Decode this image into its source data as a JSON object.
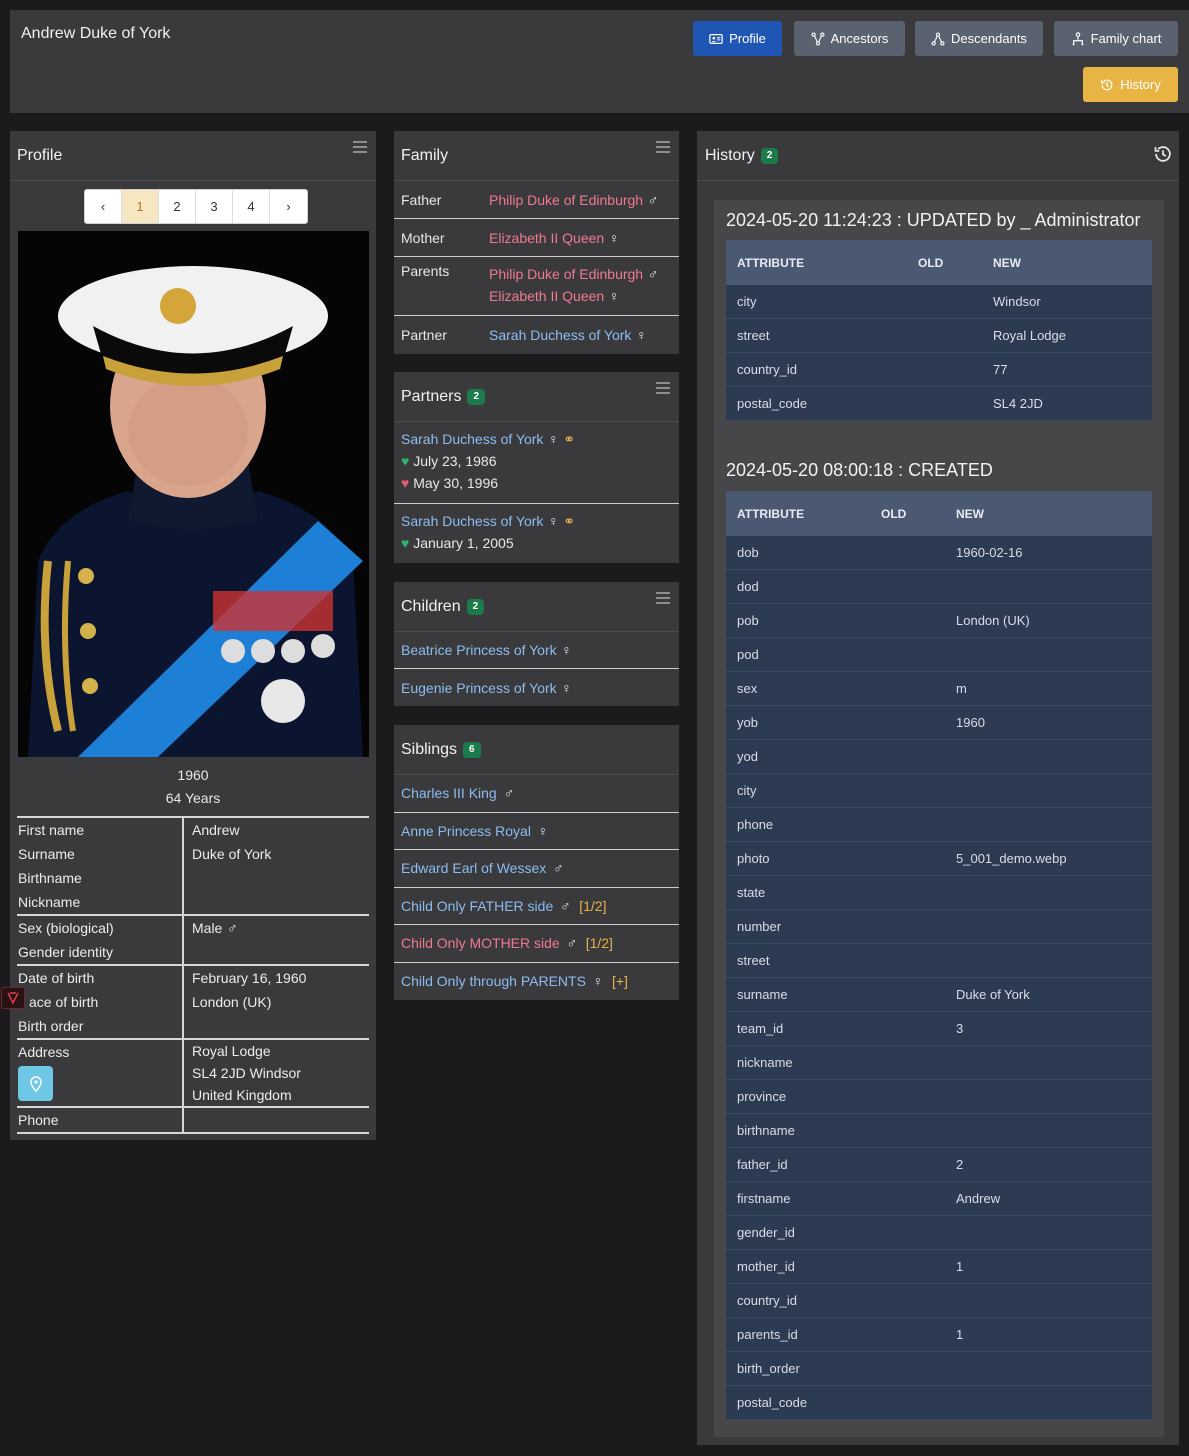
{
  "header": {
    "title": "Andrew Duke of York",
    "nav": {
      "profile": "Profile",
      "ancestors": "Ancestors",
      "descendants": "Descendants",
      "family_chart": "Family chart",
      "history": "History"
    }
  },
  "profile": {
    "title": "Profile",
    "pager": {
      "prev": "‹",
      "pages": [
        "1",
        "2",
        "3",
        "4"
      ],
      "current": "1",
      "next": "›"
    },
    "year": "1960",
    "age": "64 Years",
    "details": {
      "first_name_label": "First name",
      "first_name": "Andrew",
      "surname_label": "Surname",
      "surname": "Duke of York",
      "birthname_label": "Birthname",
      "birthname": "",
      "nickname_label": "Nickname",
      "nickname": "",
      "sex_label": "Sex (biological)",
      "sex": "Male",
      "gender_label": "Gender identity",
      "gender": "",
      "dob_label": "Date of birth",
      "dob": "February 16, 1960",
      "pob_label": "ace of birth",
      "pob": "London (UK)",
      "birth_order_label": "Birth order",
      "birth_order": "",
      "address_label": "Address",
      "address_1": "Royal Lodge",
      "address_2": "SL4 2JD Windsor",
      "address_3": "United Kingdom",
      "phone_label": "Phone",
      "phone": ""
    }
  },
  "family": {
    "title": "Family",
    "father_label": "Father",
    "father": "Philip Duke of Edinburgh",
    "mother_label": "Mother",
    "mother": "Elizabeth II Queen",
    "parents_label": "Parents",
    "parents_1": "Philip Duke of Edinburgh",
    "parents_2": "Elizabeth II Queen",
    "partner_label": "Partner",
    "partner": "Sarah Duchess of York"
  },
  "partners": {
    "title": "Partners",
    "count": "2",
    "items": [
      {
        "name": "Sarah Duchess of York",
        "married": "July 23, 1986",
        "divorced": "May 30, 1996"
      },
      {
        "name": "Sarah Duchess of York",
        "married": "January 1, 2005"
      }
    ]
  },
  "children": {
    "title": "Children",
    "count": "2",
    "items": [
      "Beatrice Princess of York",
      "Eugenie Princess of York"
    ]
  },
  "siblings": {
    "title": "Siblings",
    "count": "6",
    "items": [
      {
        "name": "Charles III King",
        "sex": "m",
        "color": "#8cbcf0",
        "suffix": ""
      },
      {
        "name": "Anne Princess Royal",
        "sex": "f",
        "color": "#8cbcf0",
        "suffix": ""
      },
      {
        "name": "Edward Earl of Wessex",
        "sex": "m",
        "color": "#8cbcf0",
        "suffix": ""
      },
      {
        "name": "Child Only FATHER side",
        "sex": "m",
        "color": "#8cbcf0",
        "suffix": "[1/2]"
      },
      {
        "name": "Child Only MOTHER side",
        "sex": "m",
        "color": "#ef7a8f",
        "suffix": "[1/2]"
      },
      {
        "name": "Child Only through PARENTS",
        "sex": "f",
        "color": "#8cbcf0",
        "suffix": "[+]"
      }
    ]
  },
  "history": {
    "title": "History",
    "count": "2",
    "entries": [
      {
        "title": "2024-05-20 11:24:23 : UPDATED by _ Administrator",
        "headers": [
          "ATTRIBUTE",
          "OLD",
          "NEW"
        ],
        "rows": [
          [
            "city",
            "",
            "Windsor"
          ],
          [
            "street",
            "",
            "Royal Lodge"
          ],
          [
            "country_id",
            "",
            "77"
          ],
          [
            "postal_code",
            "",
            "SL4 2JD"
          ]
        ]
      },
      {
        "title": "2024-05-20 08:00:18 : CREATED",
        "headers": [
          "ATTRIBUTE",
          "OLD",
          "NEW"
        ],
        "rows": [
          [
            "dob",
            "",
            "1960-02-16"
          ],
          [
            "dod",
            "",
            ""
          ],
          [
            "pob",
            "",
            "London (UK)"
          ],
          [
            "pod",
            "",
            ""
          ],
          [
            "sex",
            "",
            "m"
          ],
          [
            "yob",
            "",
            "1960"
          ],
          [
            "yod",
            "",
            ""
          ],
          [
            "city",
            "",
            ""
          ],
          [
            "phone",
            "",
            ""
          ],
          [
            "photo",
            "",
            "5_001_demo.webp"
          ],
          [
            "state",
            "",
            ""
          ],
          [
            "number",
            "",
            ""
          ],
          [
            "street",
            "",
            ""
          ],
          [
            "surname",
            "",
            "Duke of York"
          ],
          [
            "team_id",
            "",
            "3"
          ],
          [
            "nickname",
            "",
            ""
          ],
          [
            "province",
            "",
            ""
          ],
          [
            "birthname",
            "",
            ""
          ],
          [
            "father_id",
            "",
            "2"
          ],
          [
            "firstname",
            "",
            "Andrew"
          ],
          [
            "gender_id",
            "",
            ""
          ],
          [
            "mother_id",
            "",
            "1"
          ],
          [
            "country_id",
            "",
            ""
          ],
          [
            "parents_id",
            "",
            "1"
          ],
          [
            "birth_order",
            "",
            ""
          ],
          [
            "postal_code",
            "",
            ""
          ]
        ]
      }
    ]
  }
}
